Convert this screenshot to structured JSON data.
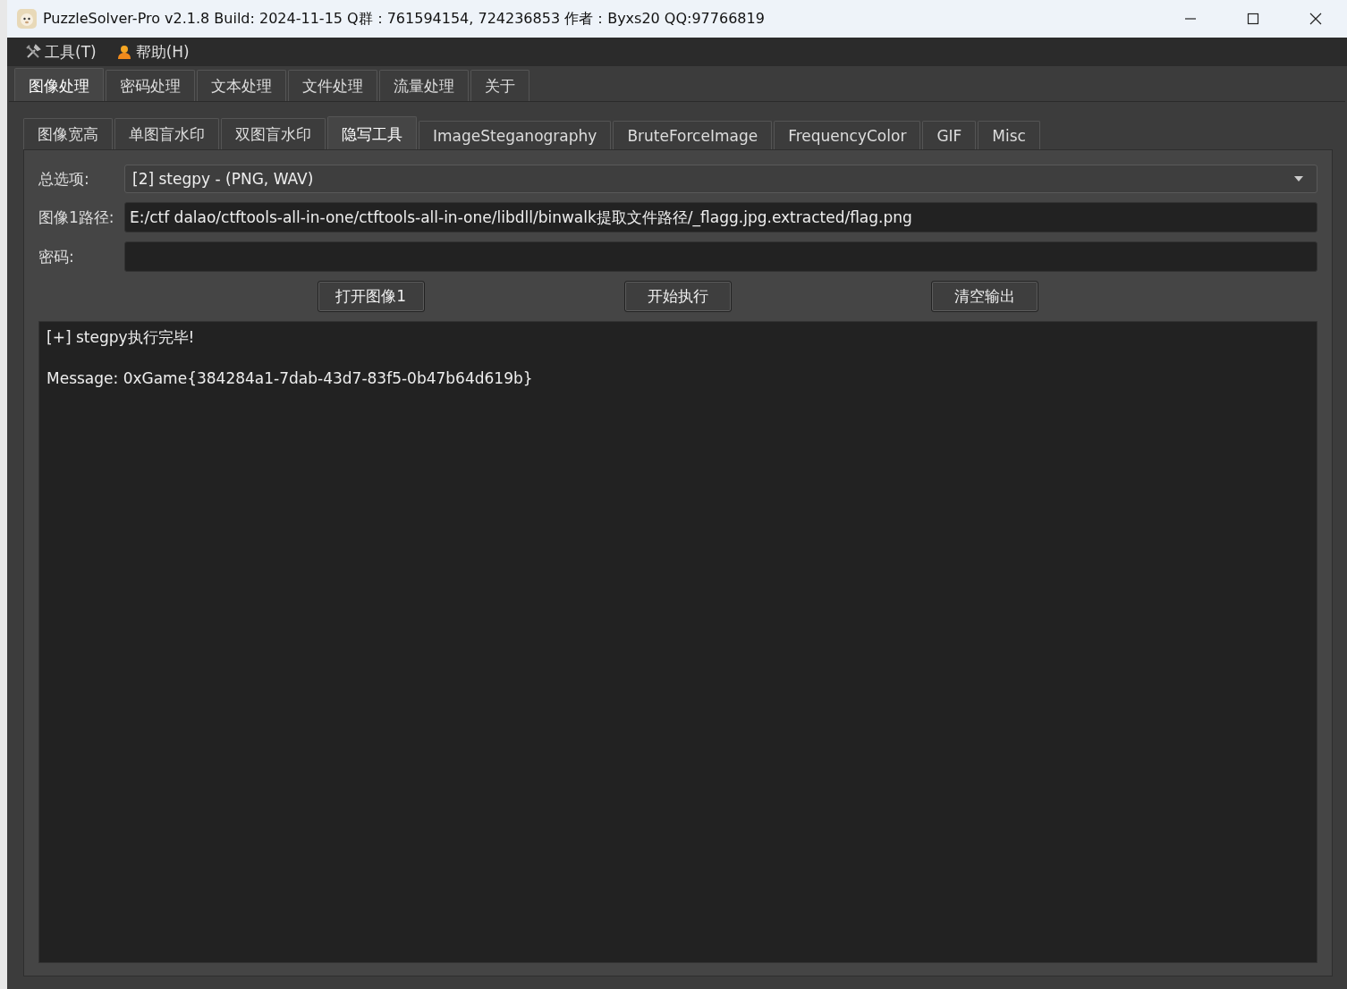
{
  "window": {
    "title": "PuzzleSolver-Pro v2.1.8  Build: 2024-11-15  Q群：761594154, 724236853  作者：Byxs20  QQ:97766819"
  },
  "menu": [
    {
      "label": "工具(T)"
    },
    {
      "label": "帮助(H)"
    }
  ],
  "tabs": [
    {
      "label": "图像处理",
      "selected": true
    },
    {
      "label": "密码处理",
      "selected": false
    },
    {
      "label": "文本处理",
      "selected": false
    },
    {
      "label": "文件处理",
      "selected": false
    },
    {
      "label": "流量处理",
      "selected": false
    },
    {
      "label": "关于",
      "selected": false
    }
  ],
  "subtabs": [
    {
      "label": "图像宽高",
      "selected": false
    },
    {
      "label": "单图盲水印",
      "selected": false
    },
    {
      "label": "双图盲水印",
      "selected": false
    },
    {
      "label": "隐写工具",
      "selected": true
    },
    {
      "label": "ImageSteganography",
      "selected": false
    },
    {
      "label": "BruteForceImage",
      "selected": false
    },
    {
      "label": "FrequencyColor",
      "selected": false
    },
    {
      "label": "GIF",
      "selected": false
    },
    {
      "label": "Misc",
      "selected": false
    }
  ],
  "fields": [
    {
      "label": "总选项:",
      "kind": "dropdown",
      "value": "[2] stegpy - (PNG, WAV)"
    },
    {
      "label": "图像1路径:",
      "kind": "text",
      "value": "E:/ctf dalao/ctftools-all-in-one/ctftools-all-in-one/libdll/binwalk提取文件路径/_flagg.jpg.extracted/flag.png"
    },
    {
      "label": "密码:",
      "kind": "text"
    }
  ],
  "buttons": [
    "打开图像1",
    "开始执行",
    "清空输出"
  ],
  "output_lines": [
    "[+] stegpy执行完毕!",
    "Message: 0xGame{384284a1-7dab-43d7-83f5-0b47b64d619b}"
  ]
}
